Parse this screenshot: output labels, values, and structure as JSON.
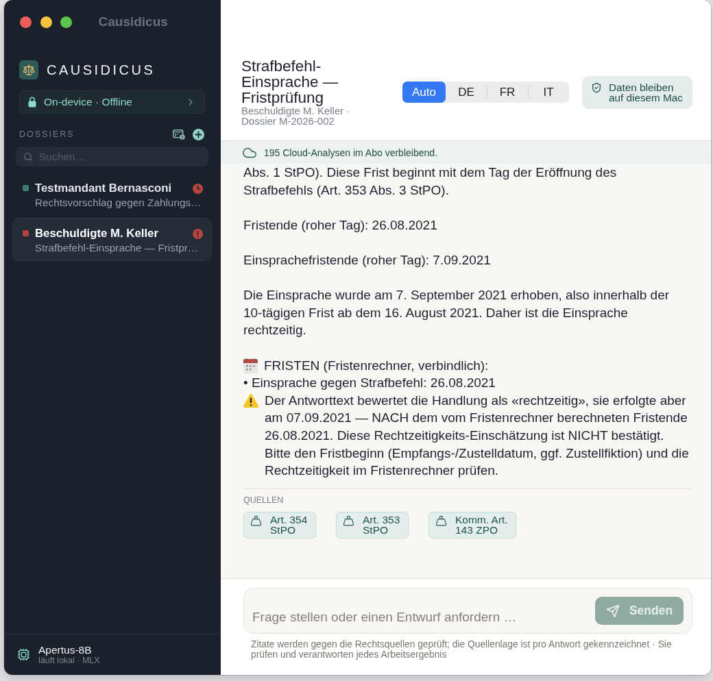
{
  "window": {
    "title": "Causidicus"
  },
  "sidebar": {
    "brand": "CAUSIDICUS",
    "mode_button": {
      "label": "On-device · Offline"
    },
    "section_title": "DOSSIERS",
    "search": {
      "placeholder": "Suchen…"
    },
    "dossiers": [
      {
        "name": "Testmandant Bernasconi",
        "subtitle": "Rechtsvorschlag gegen Zahlungs…",
        "color": "#3e7b6f",
        "overdue": false,
        "selected": false
      },
      {
        "name": "Beschuldigte M. Keller",
        "subtitle": "Strafbefehl-Einsprache — Fristpr…",
        "color": "#b2453d",
        "overdue": true,
        "selected": true
      }
    ],
    "model": {
      "name": "Apertus-8B",
      "detail": "läuft lokal · MLX"
    }
  },
  "header": {
    "title": "Strafbefehl-Einsprache — Fristprüfung",
    "subtitle": "Beschuldigte M. Keller · Dossier M-2026-002",
    "languages": [
      {
        "label": "Auto",
        "selected": true
      },
      {
        "label": "DE",
        "selected": false
      },
      {
        "label": "FR",
        "selected": false
      },
      {
        "label": "IT",
        "selected": false
      }
    ],
    "privacy_note": "Daten bleiben auf diesem Mac"
  },
  "banner": {
    "text": "195 Cloud-Analysen im Abo verbleibend."
  },
  "answer": {
    "blocks": [
      {
        "kind": "paragraph",
        "text": "Abs. 1 StPO). Diese Frist beginnt mit dem Tag der Eröffnung des Strafbefehls (Art. 353 Abs. 3 StPO)."
      },
      {
        "kind": "paragraph",
        "text": "Fristende (roher Tag): 26.08.2021"
      },
      {
        "kind": "paragraph",
        "text": "Einsprachefristende (roher Tag): 7.09.2021"
      },
      {
        "kind": "paragraph",
        "text": "Die Einsprache wurde am 7. September 2021 erhoben, also innerhalb der 10-tägigen Frist ab dem 16. August 2021. Daher ist die Einsprache rechtzeitig."
      },
      {
        "kind": "deadlines",
        "heading": "FRISTEN (Fristenrechner, verbindlich):",
        "items": [
          "• Einsprache gegen Strafbefehl: 26.08.2021"
        ],
        "warning": "Der Antworttext bewertet die Handlung als «rechtzeitig», sie erfolgte aber am 07.09.2021 — NACH dem vom Fristenrechner berechneten Fristende 26.08.2021. Diese Rechtzeitigkeits-Einschätzung ist NICHT bestätigt. Bitte den Fristbeginn (Empfangs-/Zustelldatum, ggf. Zustellfiktion) und die Rechtzeitigkeit im Fristenrechner prüfen."
      }
    ],
    "sources_title": "QUELLEN",
    "sources": [
      "Art. 354 StPO",
      "Art. 353 StPO",
      "Komm. Art. 143 ZPO"
    ]
  },
  "composer": {
    "placeholder": "Frage stellen oder einen Entwurf anfordern …",
    "send_button": {
      "label": "Senden",
      "disabled": true
    },
    "note": "Zitate werden gegen die Rechtsquellen geprüft; die Quellenlage ist pro Antwort gekennzeichnet · Sie prüfen und verantworten jedes Arbeitsergebnis"
  }
}
